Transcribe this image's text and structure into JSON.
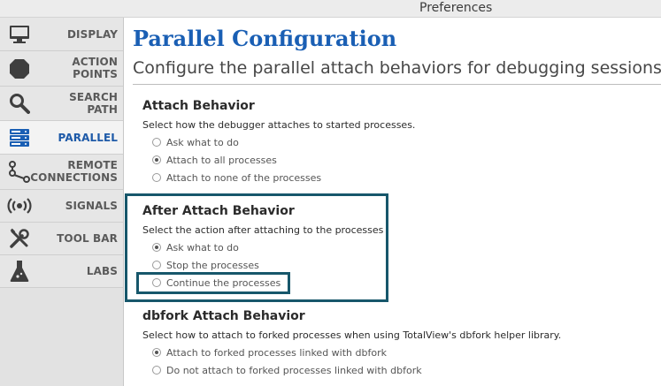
{
  "window": {
    "title": "Preferences"
  },
  "sidebar": {
    "items": [
      {
        "label_lines": [
          "DISPLAY"
        ],
        "icon": "monitor-icon",
        "active": false
      },
      {
        "label_lines": [
          "ACTION",
          "POINTS"
        ],
        "icon": "stop-octagon-icon",
        "active": false
      },
      {
        "label_lines": [
          "SEARCH",
          "PATH"
        ],
        "icon": "magnifier-icon",
        "active": false
      },
      {
        "label_lines": [
          "PARALLEL"
        ],
        "icon": "server-stack-icon",
        "active": true
      },
      {
        "label_lines": [
          "REMOTE",
          "CONNECTIONS"
        ],
        "icon": "network-nodes-icon",
        "active": false
      },
      {
        "label_lines": [
          "SIGNALS"
        ],
        "icon": "broadcast-icon",
        "active": false
      },
      {
        "label_lines": [
          "TOOL BAR"
        ],
        "icon": "tools-icon",
        "active": false
      },
      {
        "label_lines": [
          "LABS"
        ],
        "icon": "flask-icon",
        "active": false
      }
    ]
  },
  "main": {
    "title": "Parallel Configuration",
    "subtitle": "Configure the parallel attach behaviors for debugging sessions.",
    "sections": [
      {
        "title": "Attach Behavior",
        "description": "Select how the debugger attaches to started processes.",
        "options": [
          {
            "label": "Ask what to do",
            "checked": false
          },
          {
            "label": "Attach to all processes",
            "checked": true
          },
          {
            "label": "Attach to none of the processes",
            "checked": false
          }
        ]
      },
      {
        "title": "After Attach Behavior",
        "description": "Select the action after attaching to the processes",
        "options": [
          {
            "label": "Ask what to do",
            "checked": true
          },
          {
            "label": "Stop the processes",
            "checked": false
          },
          {
            "label": "Continue the processes",
            "checked": false
          }
        ]
      },
      {
        "title": "dbfork Attach Behavior",
        "description": "Select how to attach to forked processes when using TotalView's dbfork helper library.",
        "options": [
          {
            "label": "Attach to forked processes linked with dbfork",
            "checked": true
          },
          {
            "label": "Do not attach to forked processes linked with dbfork",
            "checked": false
          }
        ]
      }
    ]
  },
  "colors": {
    "accent": "#1a5fb4",
    "highlight_box": "#17576b"
  }
}
